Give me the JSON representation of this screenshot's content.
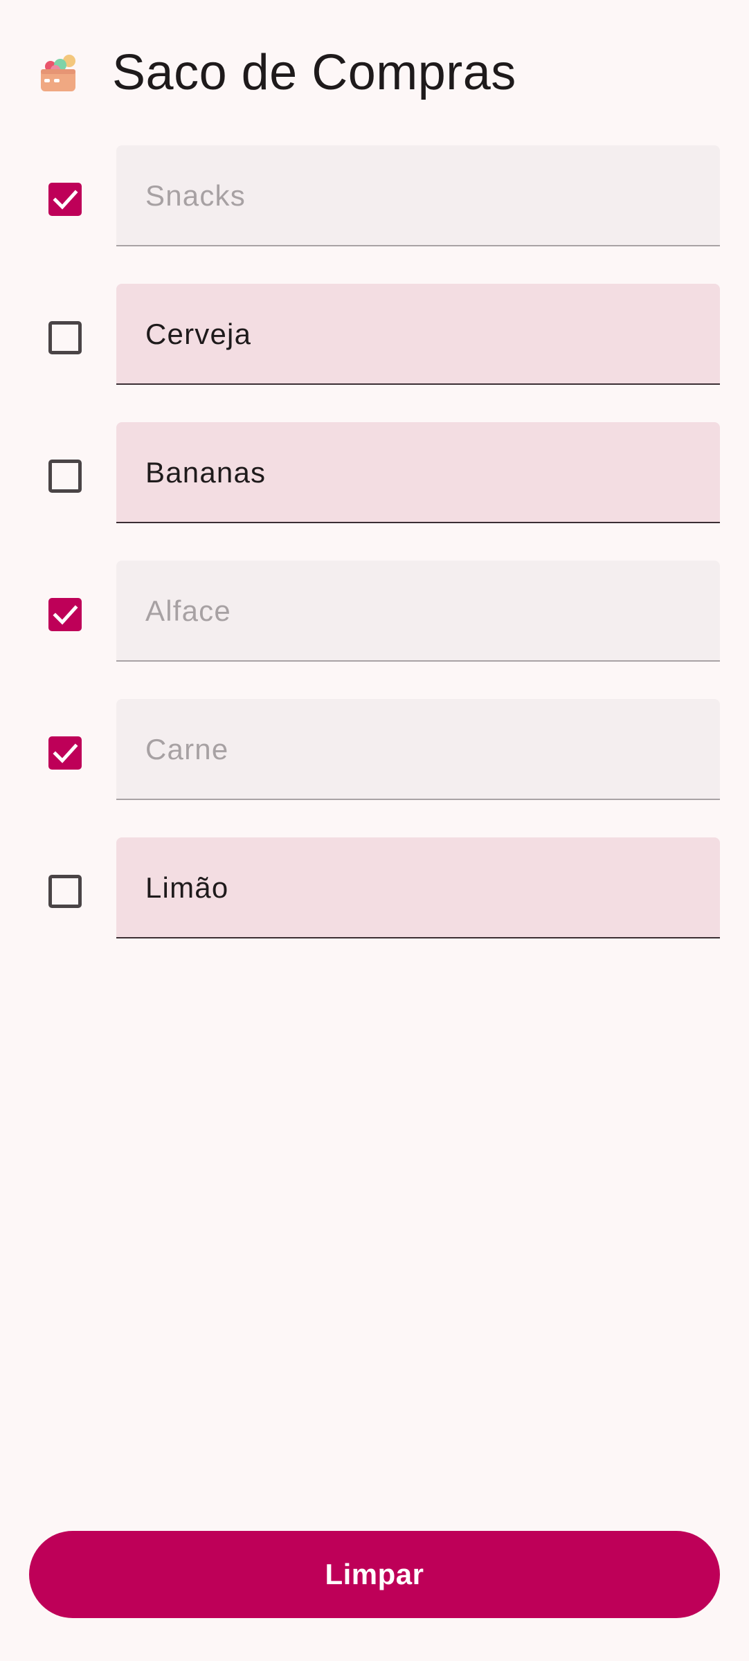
{
  "app": {
    "title": "Saco de Compras",
    "icon": "shopping-bag-groceries-icon"
  },
  "colors": {
    "primary": "#be0058",
    "background": "#fdf7f7",
    "field_active": "#f3dde2",
    "field_disabled": "#f4eeef"
  },
  "items": [
    {
      "name": "Snacks",
      "checked": true
    },
    {
      "name": "Cerveja",
      "checked": false
    },
    {
      "name": "Bananas",
      "checked": false
    },
    {
      "name": "Alface",
      "checked": true
    },
    {
      "name": "Carne",
      "checked": true
    },
    {
      "name": "Limão",
      "checked": false
    }
  ],
  "actions": {
    "clear_label": "Limpar"
  }
}
